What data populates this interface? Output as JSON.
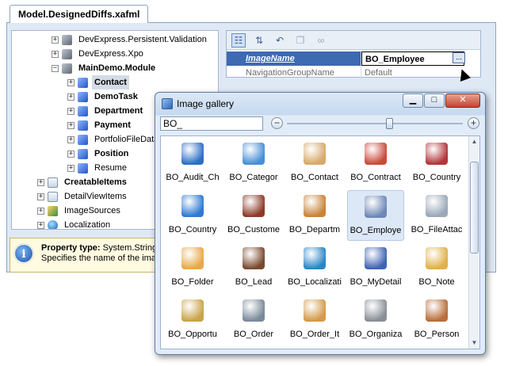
{
  "doc_tab": {
    "title": "Model.DesignedDiffs.xafml"
  },
  "tree": {
    "items": [
      {
        "label": "DevExpress.Persistent.Validation",
        "expander": "+",
        "icon": "grey",
        "bold": false
      },
      {
        "label": "DevExpress.Xpo",
        "expander": "+",
        "icon": "grey",
        "bold": false
      },
      {
        "label": "MainDemo.Module",
        "expander": "−",
        "icon": "grey",
        "bold": true
      },
      {
        "label": "Contact",
        "expander": "+",
        "icon": "blue",
        "bold": true,
        "selected": true
      },
      {
        "label": "DemoTask",
        "expander": "+",
        "icon": "blue",
        "bold": true
      },
      {
        "label": "Department",
        "expander": "+",
        "icon": "blue",
        "bold": true
      },
      {
        "label": "Payment",
        "expander": "+",
        "icon": "blue",
        "bold": true
      },
      {
        "label": "PortfolioFileData",
        "expander": "+",
        "icon": "blue",
        "bold": false
      },
      {
        "label": "Position",
        "expander": "+",
        "icon": "blue",
        "bold": true
      },
      {
        "label": "Resume",
        "expander": "+",
        "icon": "blue",
        "bold": false
      },
      {
        "label": "CreatableItems",
        "expander": "+",
        "icon": "doc",
        "bold": true
      },
      {
        "label": "DetailViewItems",
        "expander": "+",
        "icon": "doc",
        "bold": false
      },
      {
        "label": "ImageSources",
        "expander": "+",
        "icon": "img",
        "bold": false
      },
      {
        "label": "Localization",
        "expander": "+",
        "icon": "globe",
        "bold": false
      }
    ]
  },
  "status": {
    "title": "Property type:",
    "type_value": "System.String",
    "description": "Specifies the name of the image"
  },
  "properties": {
    "toolbar_icons": [
      "categorized-icon",
      "sort-az-icon",
      "undo-icon",
      "copy-icon",
      "link-icon"
    ],
    "rows": [
      {
        "name": "ImageName",
        "value": "BO_Employee",
        "selected": true
      },
      {
        "name": "NavigationGroupName",
        "value": "Default",
        "selected": false
      }
    ],
    "ellipsis_label": "..."
  },
  "gallery": {
    "title": "Image gallery",
    "search_value": "BO_",
    "zoom_minus": "−",
    "zoom_plus": "+",
    "zoom_level": 0.58,
    "items": [
      {
        "label": "BO_Audit_Ch",
        "color": "#2d6fc7"
      },
      {
        "label": "BO_Categor",
        "color": "#4a8fd6"
      },
      {
        "label": "BO_Contact",
        "color": "#d7a96b"
      },
      {
        "label": "BO_Contract",
        "color": "#c94a3a"
      },
      {
        "label": "BO_Country",
        "color": "#b2353a"
      },
      {
        "label": "BO_Country",
        "color": "#2f7ad0"
      },
      {
        "label": "BO_Custome",
        "color": "#8c3b2a"
      },
      {
        "label": "BO_Departm",
        "color": "#c9843a"
      },
      {
        "label": "BO_Employe",
        "color": "#6d88b6",
        "selected": true
      },
      {
        "label": "BO_FileAttac",
        "color": "#9aa8b8"
      },
      {
        "label": "BO_Folder",
        "color": "#e8a84a"
      },
      {
        "label": "BO_Lead",
        "color": "#7a4a2e"
      },
      {
        "label": "BO_Localizati",
        "color": "#2a86c7"
      },
      {
        "label": "BO_MyDetail",
        "color": "#4063b5"
      },
      {
        "label": "BO_Note",
        "color": "#e0b04a"
      },
      {
        "label": "BO_Opportu",
        "color": "#c9a34a"
      },
      {
        "label": "BO_Order",
        "color": "#7a8a9a"
      },
      {
        "label": "BO_Order_It",
        "color": "#d49a4a"
      },
      {
        "label": "BO_Organiza",
        "color": "#8a8f96"
      },
      {
        "label": "BO_Person",
        "color": "#b86e3a"
      }
    ]
  },
  "window_buttons": {
    "minimize": "▁",
    "maximize": "□",
    "close": "✕"
  }
}
